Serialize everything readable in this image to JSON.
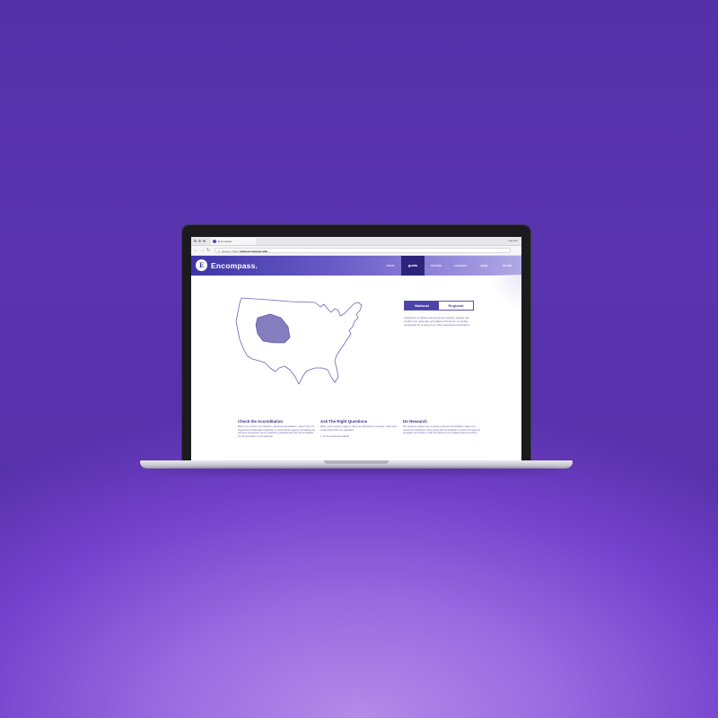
{
  "browser": {
    "tab_title": "Encompass",
    "profile": "Hannah",
    "secure_label": "Secure",
    "url_prefix": "https://",
    "url_host": "www.encompass.edu"
  },
  "site": {
    "logo_letter": "E",
    "brand": "Encompass.",
    "nav": [
      "home",
      "goals",
      "schools",
      "compare",
      "apply",
      "results"
    ],
    "active_nav": "goals"
  },
  "map_panel": {
    "toggle": [
      "National",
      "Regional"
    ],
    "active_toggle": "National",
    "description": "Institutions of higher learning across regions, degree and credits from nationally accredited schools are not widely recognized by employers or other educational institutions."
  },
  "columns": [
    {
      "title": "Check the Accreditation",
      "body": "Before you enroll in an institution, ask about accreditation. Search the U.S. Department of Education database to verify that the agency accrediting the school is recognized. Some institutions advertise that they are accredited, but the accreditor is not legitimate.",
      "item": ""
    },
    {
      "title": "Ask The Right Questions",
      "body": "When you're ready to apply or talk to an admissions counselor, make sure to ask these three key questions:",
      "item": "1. Is this school accredited?"
    },
    {
      "title": "Do Research",
      "body": "The quickest, easiest way to check a school's accreditation status is to search the institution's name along with accreditation. Look for the regional accreditor and confirm it with the agency's own website before enrolling.",
      "item": ""
    }
  ],
  "colors": {
    "brand_purple": "#3f35a6",
    "nav_active": "#2c2478",
    "map_outline": "#6d64b8",
    "map_region": "#6e67b4",
    "background": "#5631a9"
  },
  "icons": [
    "back-arrow-icon",
    "forward-arrow-icon",
    "reload-icon",
    "lock-icon"
  ]
}
